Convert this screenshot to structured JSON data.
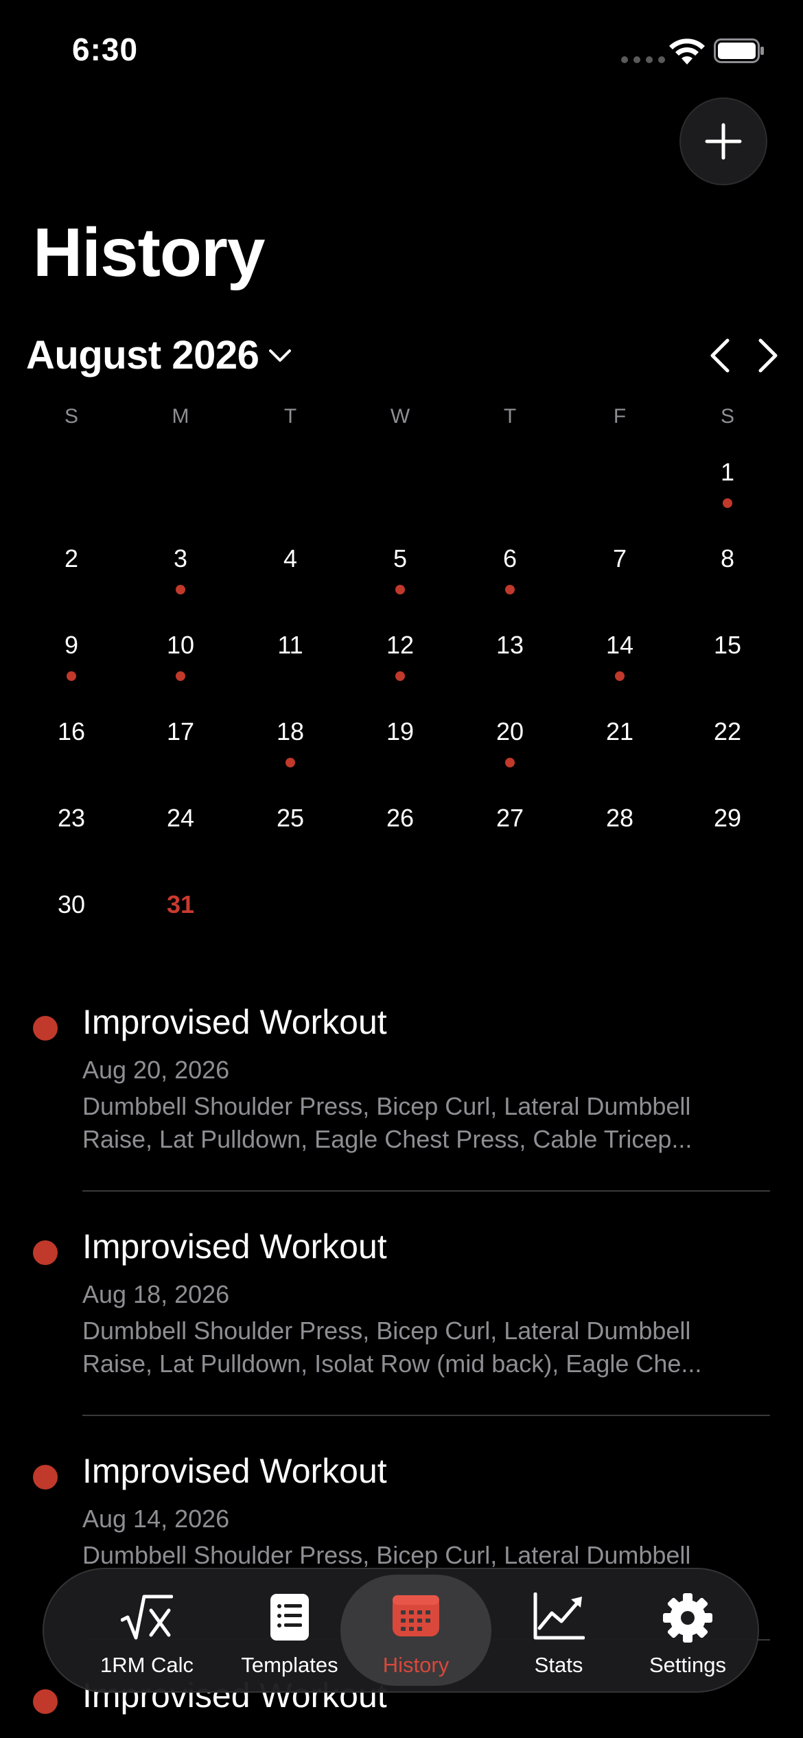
{
  "status": {
    "time": "6:30"
  },
  "header": {
    "title": "History"
  },
  "calendar": {
    "month_label": "August 2026",
    "weekdays": [
      "S",
      "M",
      "T",
      "W",
      "T",
      "F",
      "S"
    ],
    "today": 31,
    "workout_days": [
      1,
      3,
      5,
      6,
      9,
      10,
      12,
      14,
      18,
      20
    ],
    "first_weekday": 6,
    "days_in_month": 31
  },
  "workouts": [
    {
      "title": "Improvised Workout",
      "date": "Aug 20, 2026",
      "exercises": "Dumbbell Shoulder Press, Bicep Curl, Lateral Dumbbell Raise, Lat Pulldown, Eagle Chest Press, Cable Tricep..."
    },
    {
      "title": "Improvised Workout",
      "date": "Aug 18, 2026",
      "exercises": "Dumbbell Shoulder Press, Bicep Curl, Lateral Dumbbell Raise, Lat Pulldown, Isolat Row (mid back), Eagle Che..."
    },
    {
      "title": "Improvised Workout",
      "date": "Aug 14, 2026",
      "exercises": "Dumbbell Shoulder Press, Bicep Curl, Lateral Dumbbell"
    },
    {
      "title": "Improvised Workout",
      "date": "",
      "exercises": ""
    }
  ],
  "tabs": [
    {
      "label": "1RM Calc",
      "icon": "sqrt-x-icon"
    },
    {
      "label": "Templates",
      "icon": "document-list-icon"
    },
    {
      "label": "History",
      "icon": "calendar-icon",
      "active": true
    },
    {
      "label": "Stats",
      "icon": "chart-line-icon"
    },
    {
      "label": "Settings",
      "icon": "gear-icon"
    }
  ],
  "colors": {
    "accent": "#c0392b",
    "today": "#c93a2f",
    "tab_active": "#d9483b",
    "secondary_text": "#8e8e93"
  }
}
